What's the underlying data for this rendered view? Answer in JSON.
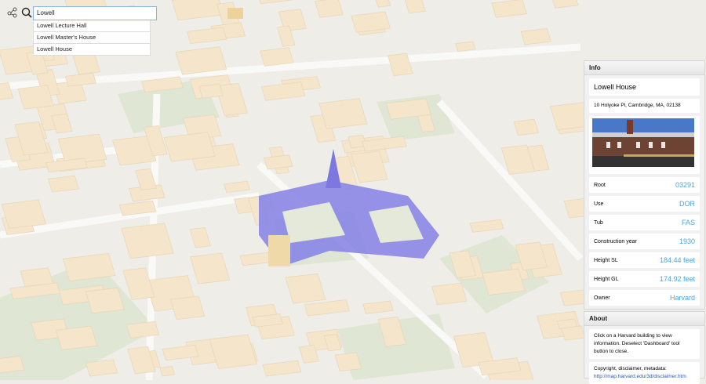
{
  "toolbar": {
    "dashboard_icon": "share-network-icon",
    "search_icon": "search-icon"
  },
  "search": {
    "value": "Lowell",
    "suggestions": [
      "Lowell Lecture Hall",
      "Lowell Master's House",
      "Lowell House"
    ]
  },
  "info": {
    "header": "Info",
    "title": "Lowell House",
    "address": "10 Holyoke Pl, Cambridge, MA, 02138",
    "rows": [
      {
        "label": "Root",
        "value": "03291"
      },
      {
        "label": "Use",
        "value": "DOR"
      },
      {
        "label": "Tub",
        "value": "FAS"
      },
      {
        "label": "Construction year",
        "value": "1930"
      },
      {
        "label": "Height SL",
        "value": "184.44 feet"
      },
      {
        "label": "Height GL",
        "value": "174.92 feet"
      },
      {
        "label": "Owner",
        "value": "Harvard"
      }
    ]
  },
  "about": {
    "header": "About",
    "text": "Click on a Harvard building to view information. Deselect 'Dashboard' tool button to close.",
    "copyright_label": "Copyright, disclaimer, metadata:",
    "link": "http://map.harvard.edu/3d/disclaimer.htm"
  },
  "colors": {
    "selected": "#8a86e6",
    "building": "#f3e3c8",
    "accent": "#4da3de"
  }
}
